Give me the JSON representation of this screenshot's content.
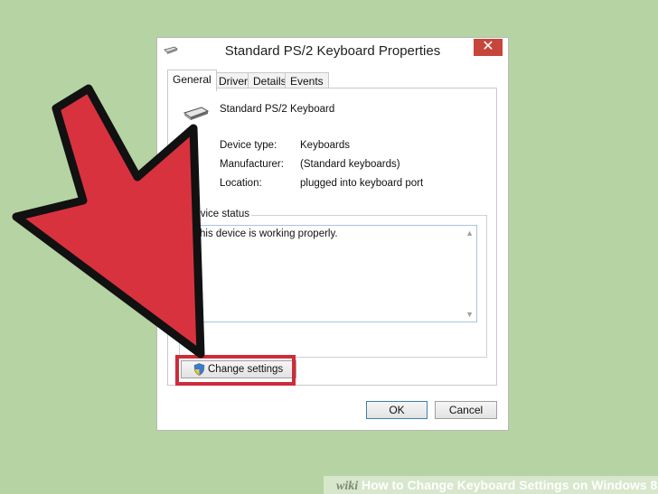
{
  "window": {
    "title": "Standard PS/2 Keyboard Properties",
    "close_glyph": "✕"
  },
  "tabs": [
    {
      "label": "General"
    },
    {
      "label": "Driver"
    },
    {
      "label": "Details"
    },
    {
      "label": "Events"
    }
  ],
  "device": {
    "name": "Standard PS/2 Keyboard",
    "icon": "keyboard-icon"
  },
  "info": {
    "type_label": "Device type:",
    "type_value": "Keyboards",
    "manufacturer_label": "Manufacturer:",
    "manufacturer_value": "(Standard keyboards)",
    "location_label": "Location:",
    "location_value": "plugged into keyboard port"
  },
  "status": {
    "group_label": "Device status",
    "text": "This device is working properly."
  },
  "buttons": {
    "change_settings": "Change settings",
    "ok": "OK",
    "cancel": "Cancel"
  },
  "watermark": {
    "brand": "wiki",
    "text": "How to Change Keyboard Settings on Windows 8"
  },
  "colors": {
    "background": "#b6d3a3",
    "arrow": "#d9323f",
    "highlight": "#cd2c3a",
    "close": "#c7463b"
  }
}
